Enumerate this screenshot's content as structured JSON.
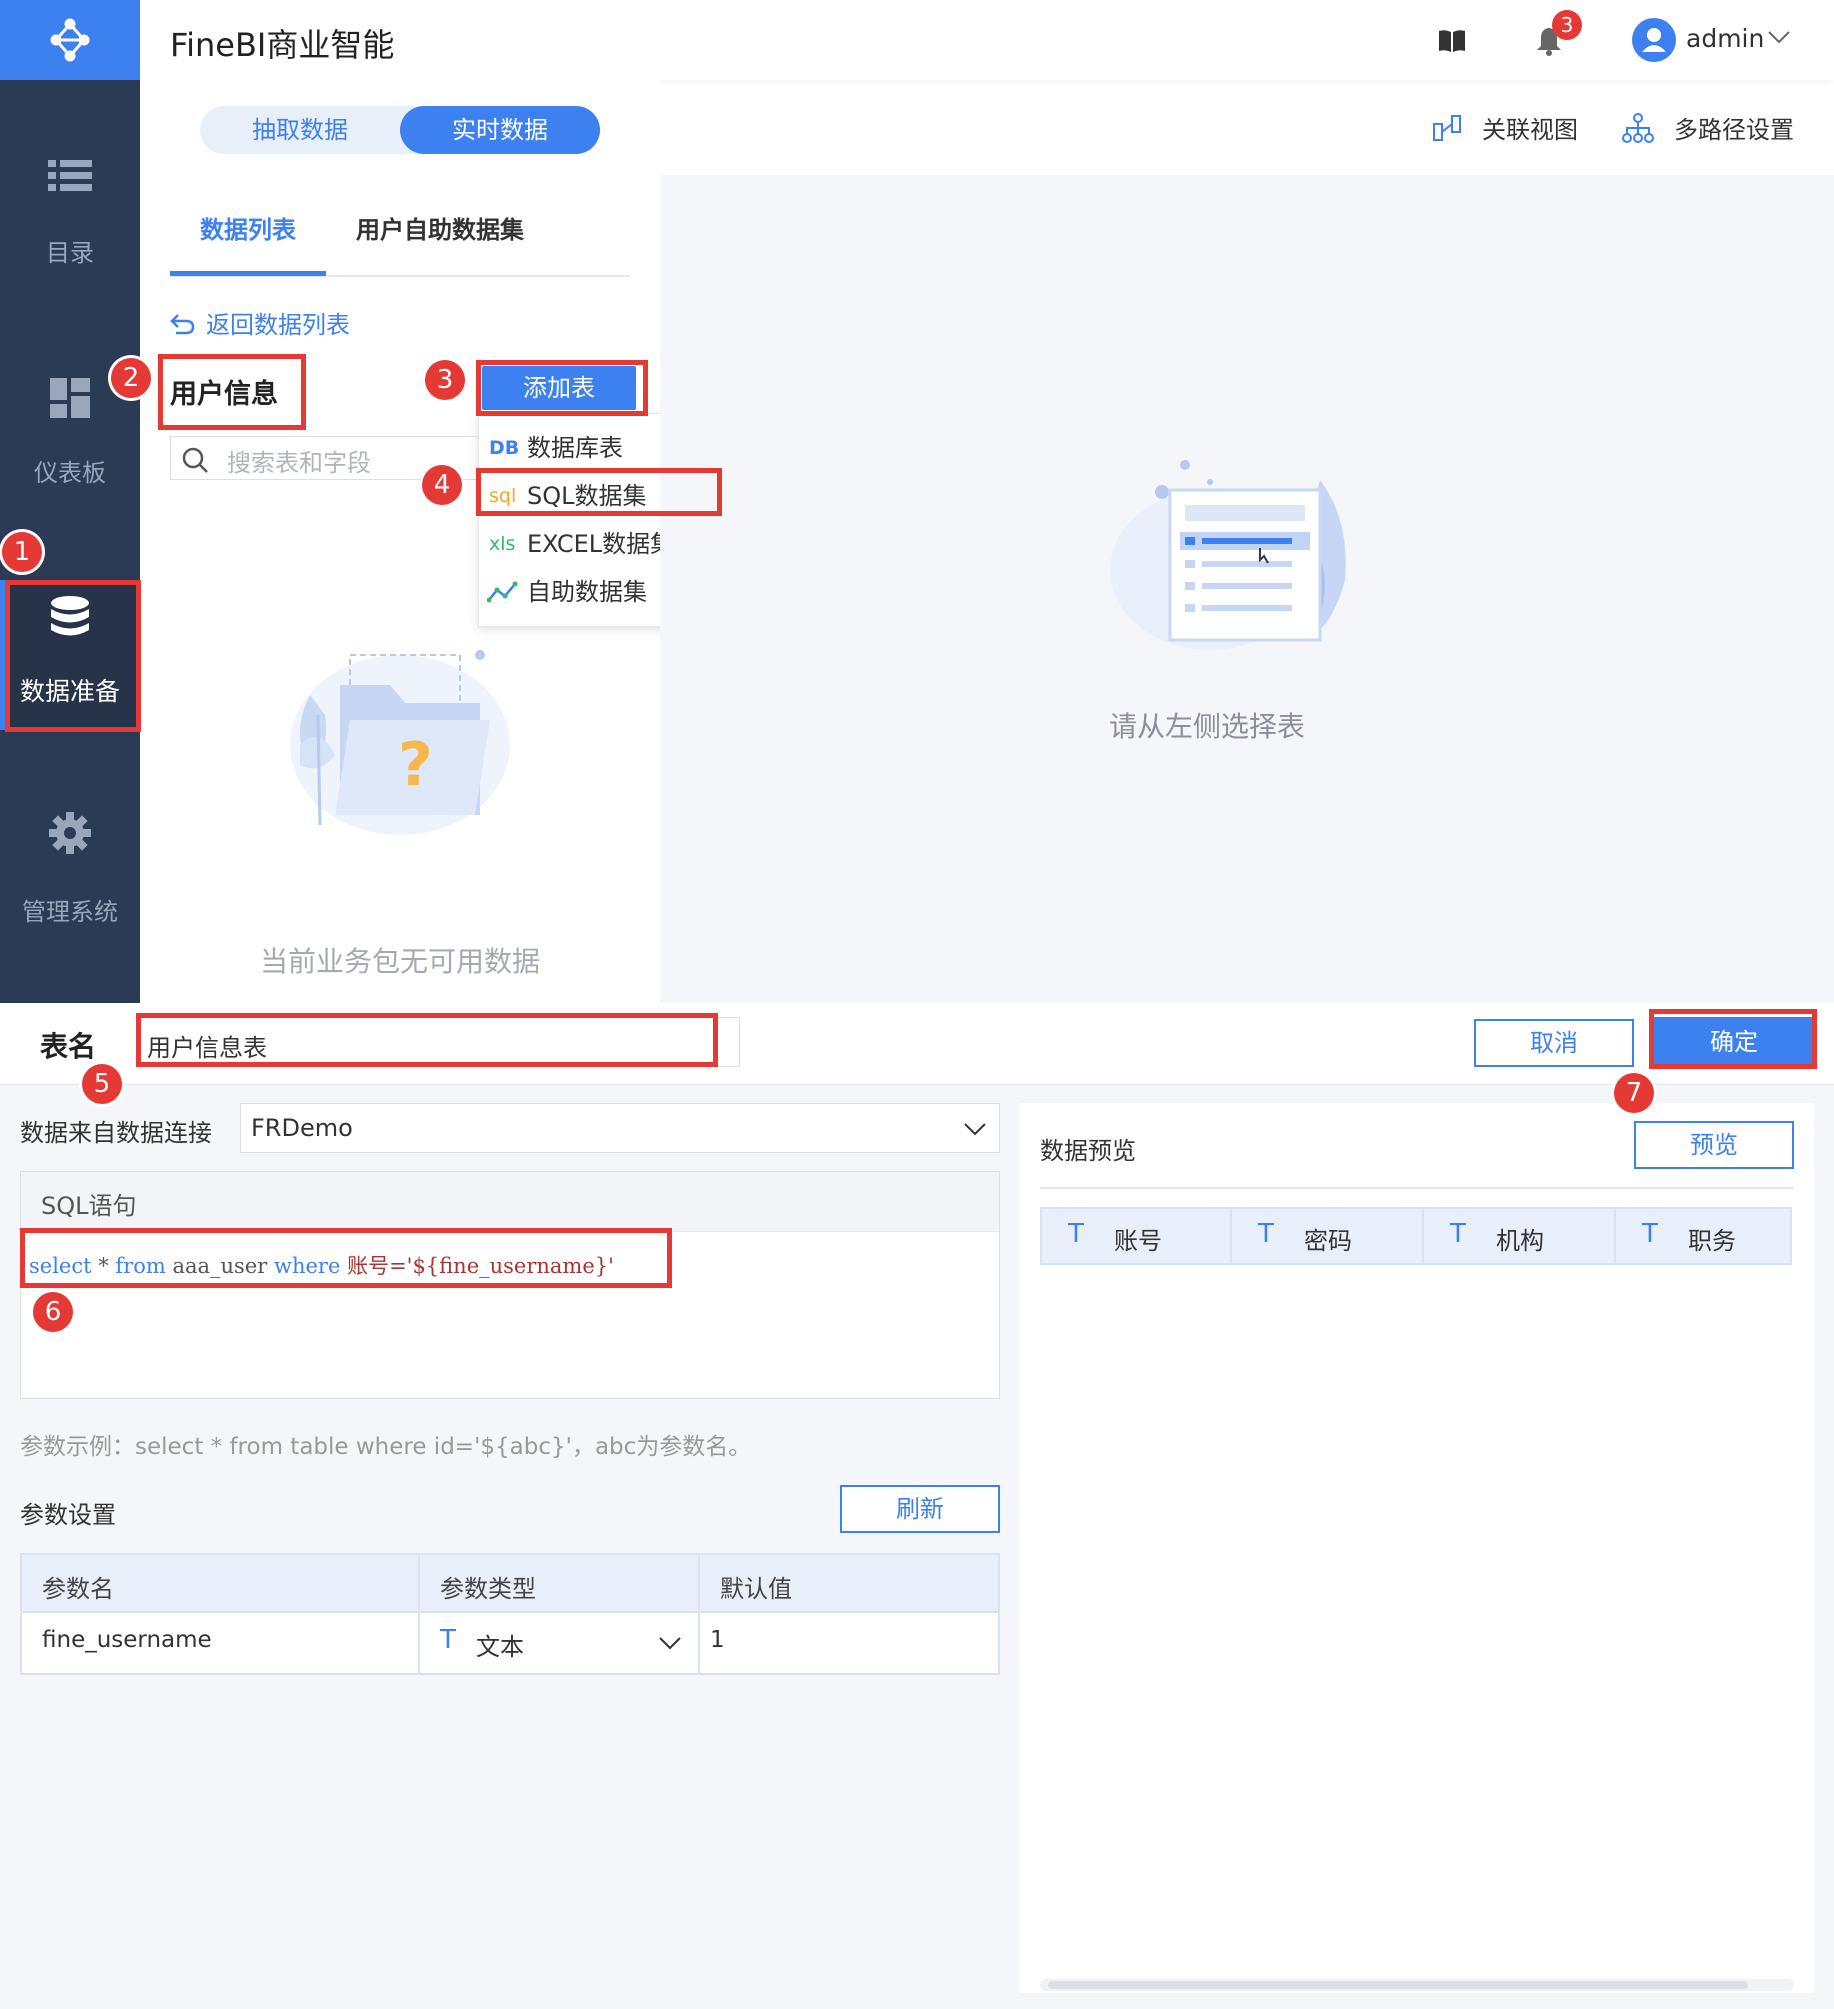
{
  "app": {
    "title": "FineBI商业智能"
  },
  "header": {
    "notification_count": "3",
    "user": "admin"
  },
  "sidebar": {
    "items": [
      {
        "label": "目录"
      },
      {
        "label": "仪表板"
      },
      {
        "label": "数据准备"
      },
      {
        "label": "管理系统"
      }
    ]
  },
  "mode_switch": {
    "extract": "抽取数据",
    "realtime": "实时数据"
  },
  "top_actions": {
    "relation_view": "关联视图",
    "multi_path": "多路径设置"
  },
  "tabs": {
    "data_list": "数据列表",
    "self_dataset": "用户自助数据集"
  },
  "back_link": "返回数据列表",
  "package_title": "用户信息",
  "add_table_button": "添加表",
  "search": {
    "placeholder": "搜索表和字段"
  },
  "add_menu": {
    "items": [
      {
        "icon": "DB",
        "label": "数据库表",
        "color": "#3d80f0"
      },
      {
        "icon": "sql",
        "label": "SQL数据集",
        "color": "#f5a623"
      },
      {
        "icon": "xls",
        "label": "EXCEL数据集",
        "color": "#2dbd6e"
      },
      {
        "icon": "chart",
        "label": "自助数据集",
        "color": "#3d80f0"
      }
    ]
  },
  "empty_left": "当前业务包无可用数据",
  "empty_right": "请从左侧选择表",
  "badges": [
    "1",
    "2",
    "3",
    "4",
    "5",
    "6",
    "7"
  ],
  "editor": {
    "table_name_label": "表名",
    "table_name_value": "用户信息表",
    "cancel": "取消",
    "confirm": "确定",
    "connection_label": "数据来自数据连接",
    "connection_value": "FRDemo",
    "sql_label": "SQL语句",
    "sql": {
      "kw1": "select",
      "star": " * ",
      "kw2": "from",
      "table": " aaa_user ",
      "kw3": "where",
      "field": " 账号='",
      "param": "${fine_username}",
      "end": "'"
    },
    "hint": "参数示例：select * from table where id='${abc}'，abc为参数名。",
    "params_label": "参数设置",
    "refresh": "刷新",
    "params_headers": [
      "参数名",
      "参数类型",
      "默认值"
    ],
    "params_rows": [
      {
        "name": "fine_username",
        "type": "文本",
        "default": "1"
      }
    ],
    "preview_label": "数据预览",
    "preview_button": "预览",
    "preview_columns": [
      "账号",
      "密码",
      "机构",
      "职务"
    ]
  },
  "colors": {
    "accent": "#3d80f0",
    "sidebar": "#2b3a55",
    "highlight": "#e53935"
  }
}
